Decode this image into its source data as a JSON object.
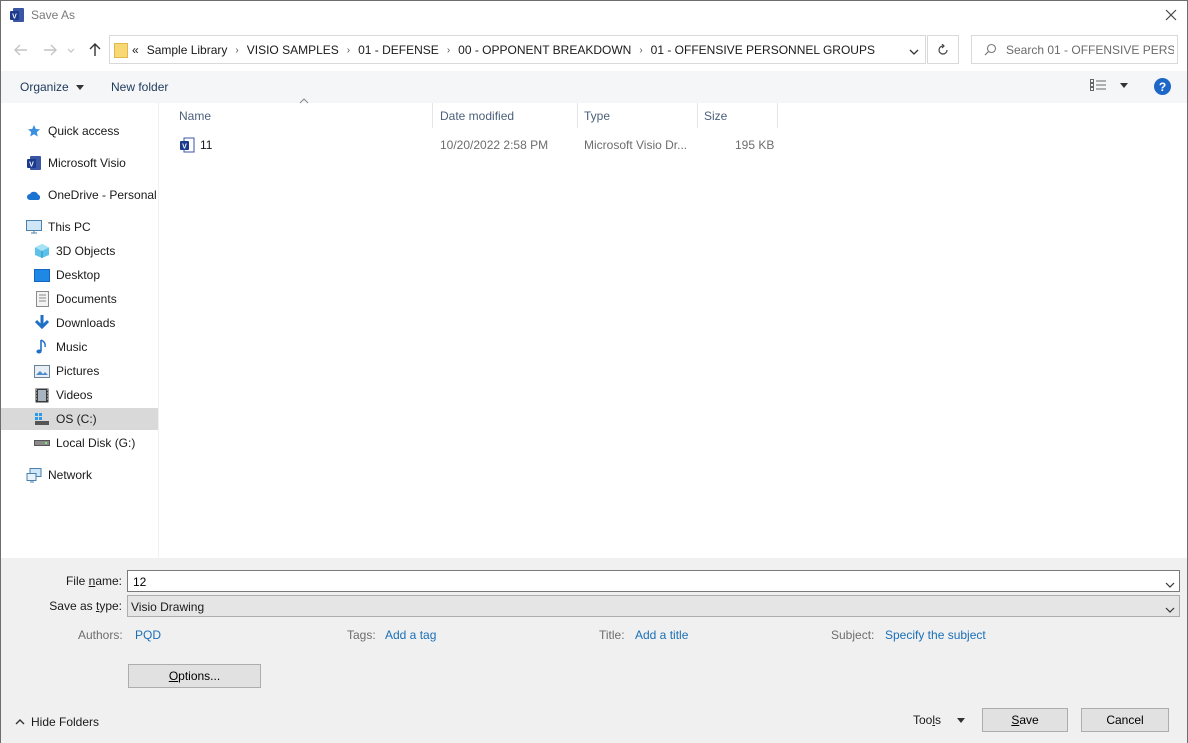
{
  "window": {
    "title": "Save As"
  },
  "address": {
    "overflow_glyph": "«",
    "crumbs": [
      "Sample Library",
      "VISIO SAMPLES",
      "01 - DEFENSE",
      "00 - OPPONENT BREAKDOWN",
      "01 - OFFENSIVE PERSONNEL GROUPS"
    ],
    "separator": "›",
    "search_placeholder": "Search 01 - OFFENSIVE PERS..."
  },
  "toolbar": {
    "organize": "Organize",
    "new_folder": "New folder",
    "help": "?"
  },
  "nav": {
    "items": [
      {
        "label": "Quick access",
        "icon": "star-icon"
      },
      {
        "label": "Microsoft Visio",
        "icon": "visio-icon"
      },
      {
        "label": "OneDrive - Personal",
        "icon": "cloud-icon"
      },
      {
        "label": "This PC",
        "icon": "computer-icon"
      },
      {
        "label": "3D Objects",
        "icon": "cube-icon"
      },
      {
        "label": "Desktop",
        "icon": "desktop-icon"
      },
      {
        "label": "Documents",
        "icon": "document-icon"
      },
      {
        "label": "Downloads",
        "icon": "download-icon"
      },
      {
        "label": "Music",
        "icon": "music-icon"
      },
      {
        "label": "Pictures",
        "icon": "pictures-icon"
      },
      {
        "label": "Videos",
        "icon": "video-icon"
      },
      {
        "label": "OS (C:)",
        "icon": "drive-os-icon",
        "selected": true
      },
      {
        "label": "Local Disk (G:)",
        "icon": "drive-icon"
      },
      {
        "label": "Network",
        "icon": "network-icon"
      }
    ]
  },
  "filelist": {
    "columns": [
      "Name",
      "Date modified",
      "Type",
      "Size"
    ],
    "rows": [
      {
        "name": "11",
        "date": "10/20/2022 2:58 PM",
        "type": "Microsoft Visio Dr...",
        "size": "195 KB"
      }
    ]
  },
  "form": {
    "file_name_label_pre": "File ",
    "file_name_label_acc": "n",
    "file_name_label_post": "ame:",
    "file_name_value": "12",
    "save_type_label_pre": "Save as ",
    "save_type_label_acc": "t",
    "save_type_label_post": "ype:",
    "save_type_value": "Visio Drawing",
    "authors_label": "Authors:",
    "authors_value": "PQD",
    "tags_label": "Tags:",
    "tags_value": "Add a tag",
    "title_label": "Title:",
    "title_value": "Add a title",
    "subject_label": "Subject:",
    "subject_value": "Specify the subject"
  },
  "buttons": {
    "options_acc": "O",
    "options_rest": "ptions...",
    "hide_folders": "Hide Folders",
    "tools_pre": "Too",
    "tools_acc": "l",
    "tools_post": "s",
    "save_acc": "S",
    "save_rest": "ave",
    "cancel": "Cancel"
  },
  "colors": {
    "accent": "#1c67c7",
    "link": "#1a6fb7",
    "toolbar_bg": "#f5f6f7",
    "panel_bg": "#f0f0f0",
    "selected_bg": "#d9d9d9"
  }
}
